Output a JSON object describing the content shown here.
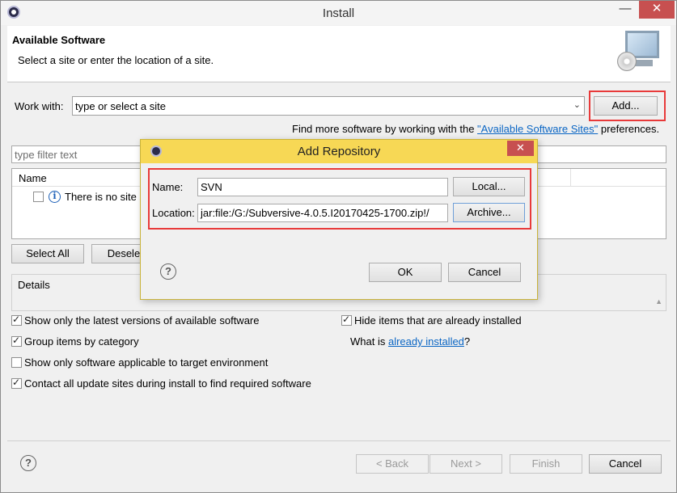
{
  "window": {
    "title": "Install",
    "minimize_glyph": "—",
    "close_glyph": "✕"
  },
  "header": {
    "title": "Available Software",
    "subtitle": "Select a site or enter the location of a site."
  },
  "work_with": {
    "label": "Work with:",
    "value": "type or select a site",
    "add_button": "Add...",
    "find_more_prefix": "Find more software by working with the ",
    "find_more_link": "\"Available Software Sites\"",
    "find_more_suffix": " preferences."
  },
  "filter": {
    "placeholder": "type filter text"
  },
  "tree": {
    "column_name": "Name",
    "row_text": "There is no site s"
  },
  "selection_buttons": {
    "select_all": "Select All",
    "deselect": "Deselect"
  },
  "details": {
    "label": "Details"
  },
  "options": {
    "latest_versions": "Show only the latest versions of available software",
    "group_by_category": "Group items by category",
    "applicable_only": "Show only software applicable to target environment",
    "contact_all_sites": "Contact all update sites during install to find required software",
    "hide_installed": "Hide items that are already installed",
    "what_is_prefix": "What is ",
    "what_is_link": "already installed",
    "what_is_suffix": "?"
  },
  "footer": {
    "back": "< Back",
    "next": "Next >",
    "finish": "Finish",
    "cancel": "Cancel"
  },
  "dialog": {
    "title": "Add Repository",
    "close_glyph": "✕",
    "name_label": "Name:",
    "name_value": "SVN",
    "local_button": "Local...",
    "location_label": "Location:",
    "location_value": "jar:file:/G:/Subversive-4.0.5.I20170425-1700.zip!/",
    "archive_button": "Archive...",
    "ok": "OK",
    "cancel": "Cancel",
    "help_glyph": "?"
  },
  "colors": {
    "dialog_title_bg": "#f7d855",
    "close_bg": "#c75050",
    "highlight_box": "#e83a3a",
    "link": "#0b66c4"
  },
  "icons": [
    "eclipse-app-icon",
    "monitor-cd-icon",
    "info-icon",
    "help-icon",
    "checkbox-icon",
    "close-icon",
    "minimize-icon",
    "dropdown-arrow-icon"
  ]
}
